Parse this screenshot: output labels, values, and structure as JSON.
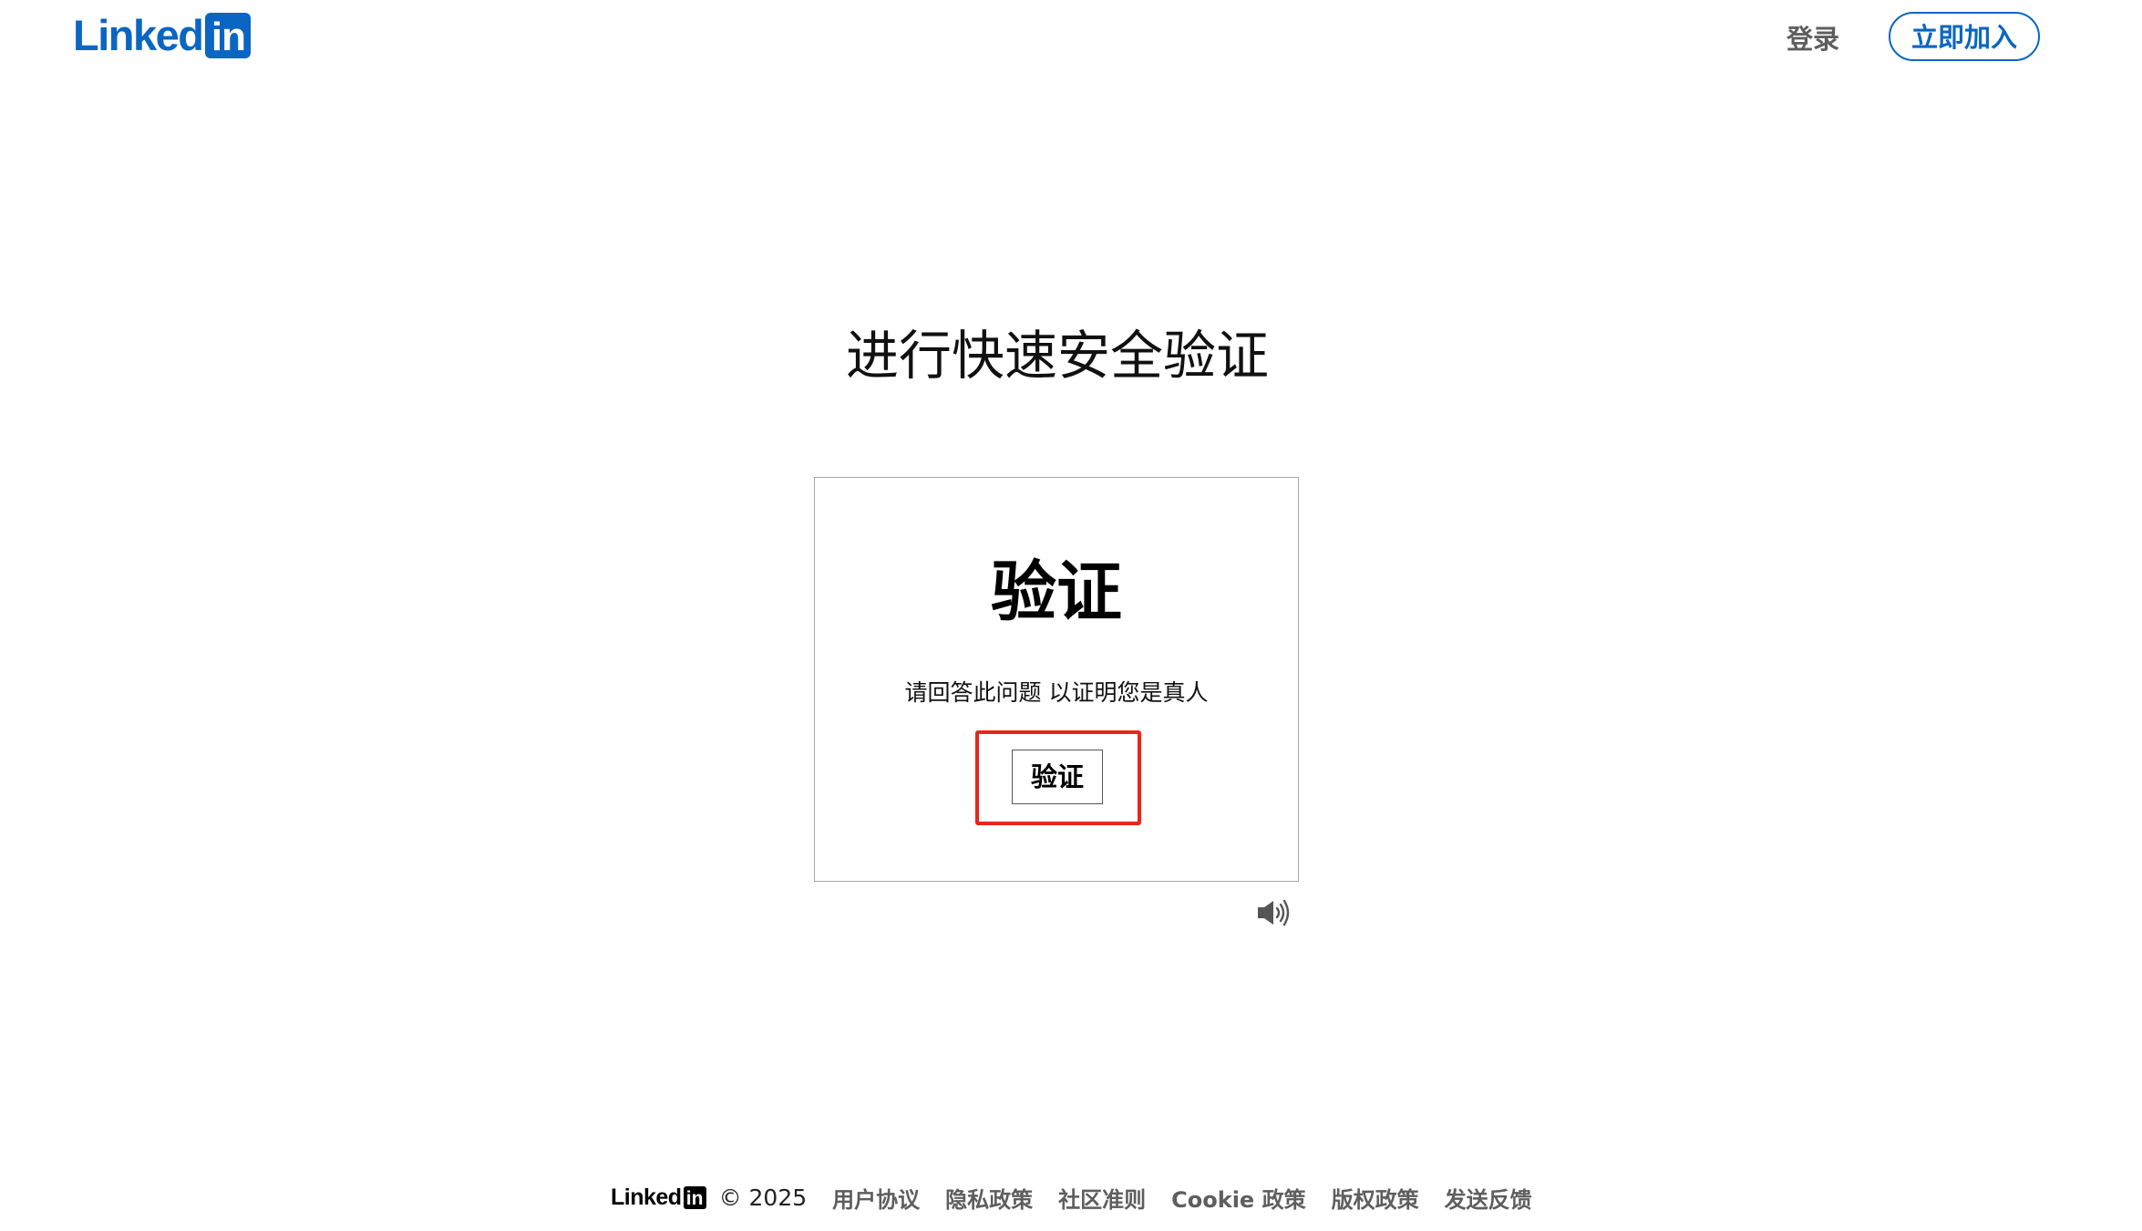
{
  "header": {
    "logo": {
      "word": "Linked",
      "box": "in"
    },
    "signin_label": "登录",
    "join_label": "立即加入"
  },
  "main": {
    "title": "进行快速安全验证",
    "card": {
      "heading": "验证",
      "prompt": "请回答此问题 以证明您是真人",
      "verify_button_label": "验证",
      "highlight_color": "#e8261c"
    },
    "audio_icon": "speaker-icon"
  },
  "footer": {
    "logo": {
      "word": "Linked",
      "box": "in"
    },
    "copyright": "© 2025",
    "links": [
      "用户协议",
      "隐私政策",
      "社区准则",
      "Cookie 政策",
      "版权政策",
      "发送反馈"
    ]
  },
  "colors": {
    "brand": "#0a66c2",
    "link_gray": "#5e5e5e",
    "highlight": "#e8261c"
  }
}
